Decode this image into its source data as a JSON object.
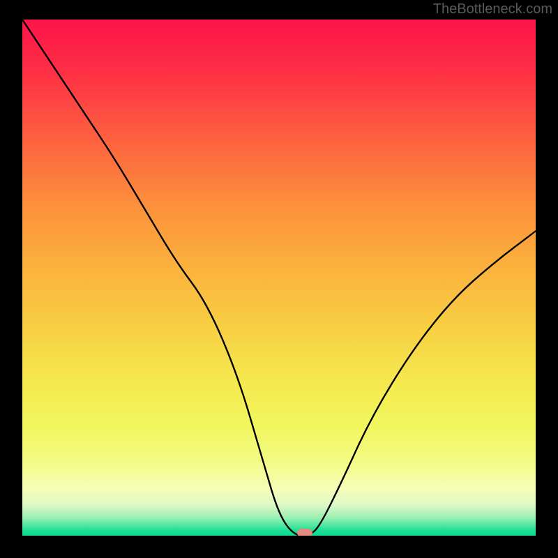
{
  "watermark": "TheBottleneck.com",
  "chart_data": {
    "type": "line",
    "title": "",
    "xlabel": "",
    "ylabel": "",
    "xlim": [
      0,
      100
    ],
    "ylim": [
      0,
      100
    ],
    "series": [
      {
        "name": "bottleneck-curve",
        "x": [
          0,
          6,
          12,
          18,
          24,
          30,
          36,
          42,
          47,
          50,
          53,
          56,
          58,
          62,
          68,
          76,
          84,
          92,
          100
        ],
        "y": [
          100,
          91,
          82,
          73,
          63,
          53,
          45,
          31,
          14,
          4,
          0,
          0,
          2,
          10,
          23,
          36,
          46,
          53,
          59
        ]
      }
    ],
    "marker": {
      "x": 55,
      "y": 0.5
    },
    "gradient_stops": [
      {
        "pct": 0,
        "color": "#fd1449"
      },
      {
        "pct": 24,
        "color": "#fd643f"
      },
      {
        "pct": 48,
        "color": "#fbb23d"
      },
      {
        "pct": 70,
        "color": "#f5e84e"
      },
      {
        "pct": 91,
        "color": "#f6fdb8"
      },
      {
        "pct": 100,
        "color": "#0bdc92"
      }
    ]
  }
}
